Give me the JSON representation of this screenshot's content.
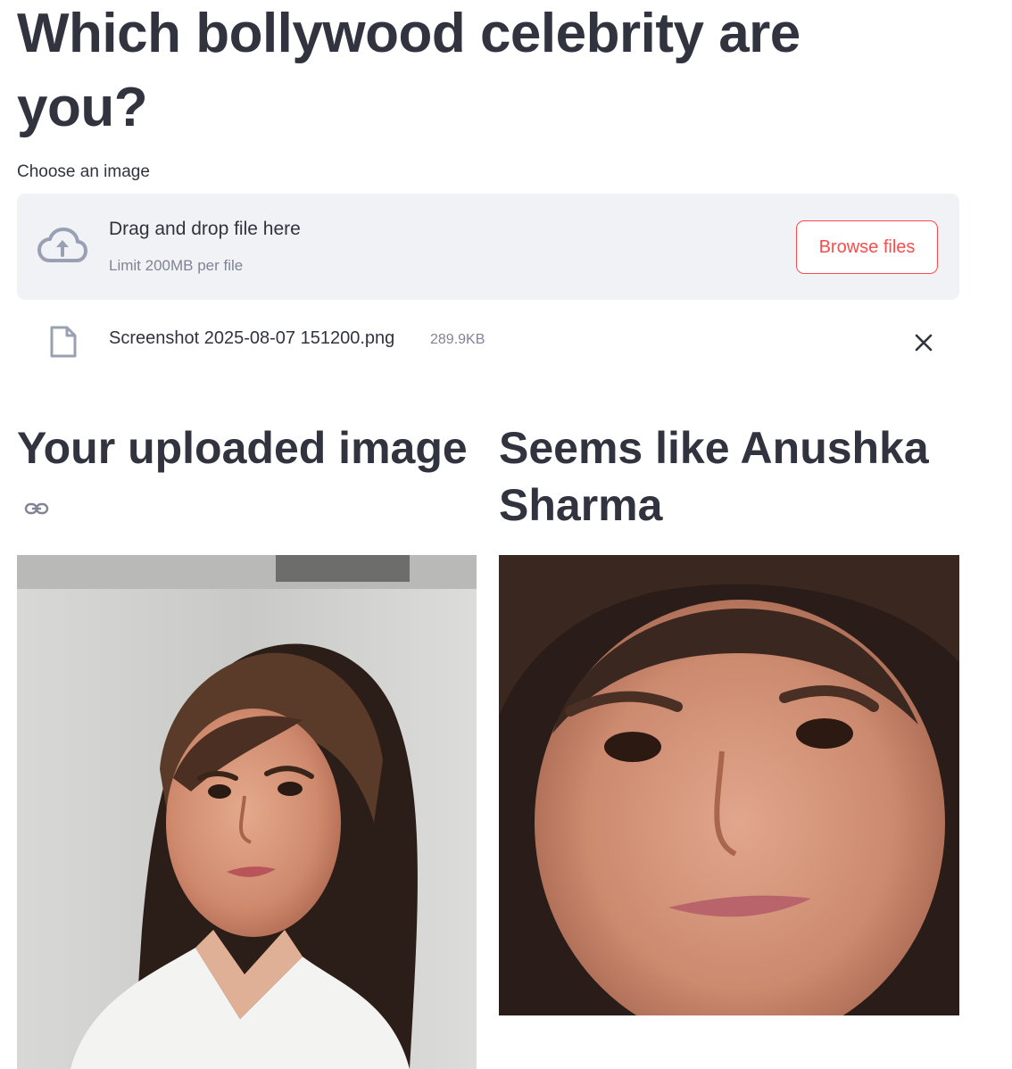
{
  "page": {
    "title": "Which bollywood celebrity are you?"
  },
  "uploader": {
    "label": "Choose an image",
    "drop_text": "Drag and drop file here",
    "limit_text": "Limit 200MB per file",
    "browse_label": "Browse files",
    "icon": "cloud-upload-icon"
  },
  "uploaded_file": {
    "name": "Screenshot 2025-08-07 151200.png",
    "size": "289.9KB",
    "icon": "file-icon",
    "remove_icon": "close-icon"
  },
  "left_column": {
    "heading": "Your uploaded image",
    "anchor_icon": "link-icon"
  },
  "right_column": {
    "heading": "Seems like Anushka Sharma"
  },
  "colors": {
    "accent": "#ff4b4b",
    "text": "#31333f",
    "muted": "#808495",
    "dropzone_bg": "#f0f2f6"
  }
}
